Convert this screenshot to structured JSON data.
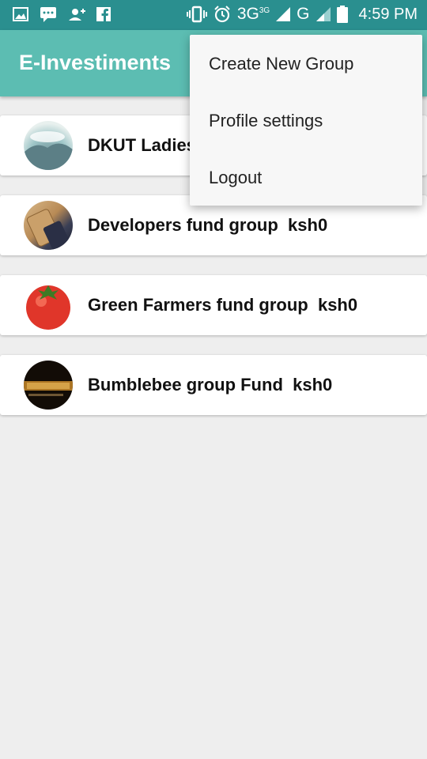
{
  "status_bar": {
    "network_3g": "3G",
    "network_3g_sup": "3G",
    "network_g": "G",
    "time": "4:59 PM"
  },
  "app_bar": {
    "title": "E-Investiments"
  },
  "groups": [
    {
      "name": "DKUT Ladies",
      "amount": "",
      "avatar_color": "#9fc6c8"
    },
    {
      "name": "Developers fund group",
      "amount": "ksh0",
      "avatar_color": "#b88a55"
    },
    {
      "name": "Green Farmers fund group",
      "amount": "ksh0",
      "avatar_color": "#e0362a"
    },
    {
      "name": "Bumblebee group Fund",
      "amount": "ksh0",
      "avatar_color": "#2a1d10"
    }
  ],
  "menu": {
    "items": [
      "Create New Group",
      "Profile settings",
      "Logout"
    ]
  },
  "colors": {
    "status_bar": "#2a8f8f",
    "app_bar": "#5cbdb2",
    "background": "#eeeeee"
  }
}
